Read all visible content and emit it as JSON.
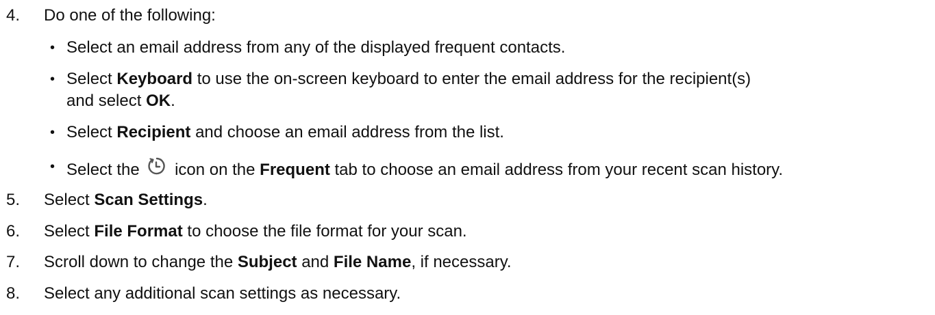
{
  "steps": [
    {
      "num": "4.",
      "text": "Do one of the following:"
    },
    {
      "num": "5.",
      "pre": "Select ",
      "bold": "Scan Settings",
      "post": "."
    },
    {
      "num": "6.",
      "pre": "Select ",
      "bold": "File Format",
      "post": " to choose the file format for your scan."
    },
    {
      "num": "7.",
      "pre": "Scroll down to change the ",
      "bold": "Subject",
      "mid": " and ",
      "bold2": "File Name",
      "post": ", if necessary."
    },
    {
      "num": "8.",
      "text": "Select any additional scan settings as necessary."
    }
  ],
  "bullets": [
    {
      "text": "Select an email address from any of the displayed frequent contacts."
    },
    {
      "pre": "Select ",
      "bold": "Keyboard",
      "post": " to use the on-screen keyboard to enter the email address for the recipient(s)",
      "line2_pre": "and select ",
      "line2_bold": "OK",
      "line2_post": "."
    },
    {
      "pre": "Select ",
      "bold": "Recipient",
      "post": " and choose an email address from the list."
    },
    {
      "pre": "Select the ",
      "icon": "history-icon",
      "mid": " icon on the ",
      "bold": "Frequent",
      "post": " tab to choose an email address from your recent scan history."
    }
  ],
  "bullet_char": "•"
}
